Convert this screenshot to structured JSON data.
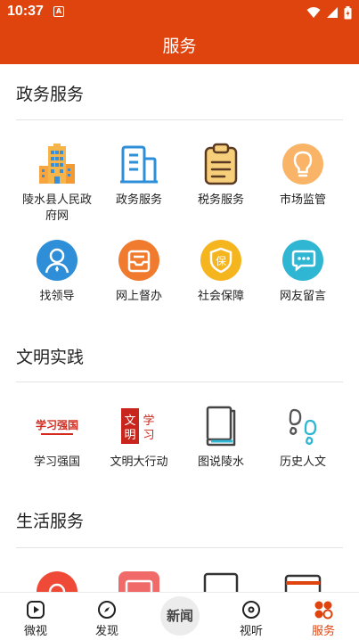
{
  "status_bar": {
    "time": "10:37",
    "notification_glyph": "A"
  },
  "header": {
    "title": "服务"
  },
  "sections": [
    {
      "title": "政务服务"
    },
    {
      "title": "文明实践"
    },
    {
      "title": "生活服务"
    }
  ],
  "gov_services": [
    {
      "label": "陵水县人民政府网",
      "icon": "building-icon"
    },
    {
      "label": "政务服务",
      "icon": "office-building-icon"
    },
    {
      "label": "税务服务",
      "icon": "clipboard-icon"
    },
    {
      "label": "市场监管",
      "icon": "lightbulb-icon"
    },
    {
      "label": "找领导",
      "icon": "person-icon"
    },
    {
      "label": "网上督办",
      "icon": "inbox-icon"
    },
    {
      "label": "社会保障",
      "icon": "shield-icon"
    },
    {
      "label": "网友留言",
      "icon": "chat-icon"
    }
  ],
  "civic_practice": [
    {
      "label": "学习强国",
      "icon": "xuexi-logo",
      "logo_text": "学习强国"
    },
    {
      "label": "文明大行动",
      "icon": "seal-logo",
      "logo_text": "文明 学习"
    },
    {
      "label": "图说陵水",
      "icon": "book-icon"
    },
    {
      "label": "历史人文",
      "icon": "footprints-icon"
    }
  ],
  "tabs": [
    {
      "label": "微视",
      "icon": "play-icon",
      "active": false
    },
    {
      "label": "发现",
      "icon": "compass-icon",
      "active": false
    },
    {
      "label": "新闻",
      "icon": "news-logo",
      "active": false
    },
    {
      "label": "视听",
      "icon": "disc-icon",
      "active": false
    },
    {
      "label": "服务",
      "icon": "services-icon",
      "active": true
    }
  ],
  "colors": {
    "brand": "#e0440e",
    "blue": "#2e8fd8",
    "orange": "#f07a2e",
    "yellow": "#f5b51e",
    "teal": "#2fb6d3"
  }
}
